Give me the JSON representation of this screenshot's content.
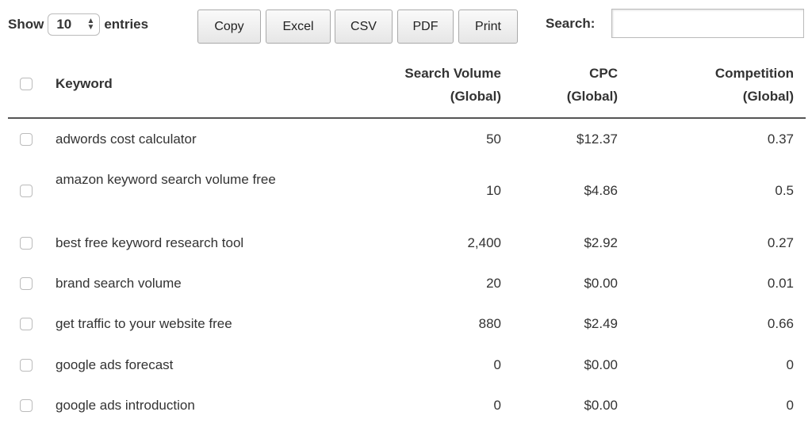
{
  "controls": {
    "show_label": "Show",
    "entries_value": "10",
    "entries_label": "entries",
    "buttons": [
      "Copy",
      "Excel",
      "CSV",
      "PDF",
      "Print"
    ],
    "search_label": "Search:",
    "search_value": ""
  },
  "table": {
    "headers": {
      "keyword": "Keyword",
      "volume_1": "Search Volume",
      "volume_2": "(Global)",
      "cpc_1": "CPC",
      "cpc_2": "(Global)",
      "comp_1": "Competition",
      "comp_2": "(Global)"
    },
    "rows": [
      {
        "keyword": "adwords cost calculator",
        "volume": "50",
        "cpc": "$12.37",
        "competition": "0.37"
      },
      {
        "keyword": "amazon keyword search volume free",
        "volume": "10",
        "cpc": "$4.86",
        "competition": "0.5"
      },
      {
        "keyword": "best free keyword research tool",
        "volume": "2,400",
        "cpc": "$2.92",
        "competition": "0.27"
      },
      {
        "keyword": "brand search volume",
        "volume": "20",
        "cpc": "$0.00",
        "competition": "0.01"
      },
      {
        "keyword": "get traffic to your website free",
        "volume": "880",
        "cpc": "$2.49",
        "competition": "0.66"
      },
      {
        "keyword": "google ads forecast",
        "volume": "0",
        "cpc": "$0.00",
        "competition": "0"
      },
      {
        "keyword": "google ads introduction",
        "volume": "0",
        "cpc": "$0.00",
        "competition": "0"
      }
    ]
  }
}
